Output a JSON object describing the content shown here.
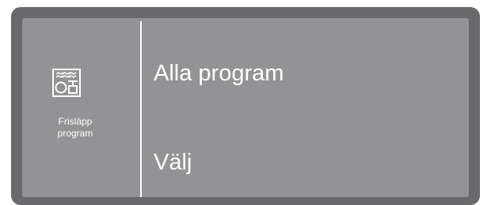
{
  "colors": {
    "bezel": "#69696b",
    "screen": "#939395",
    "foreground": "#ffffff"
  },
  "left_panel": {
    "icon": "dishwasher-release-program-icon",
    "caption_line1": "Frisläpp",
    "caption_line2": "program"
  },
  "menu": {
    "items": [
      {
        "label": "Alla program"
      },
      {
        "label": "Välj"
      }
    ]
  }
}
